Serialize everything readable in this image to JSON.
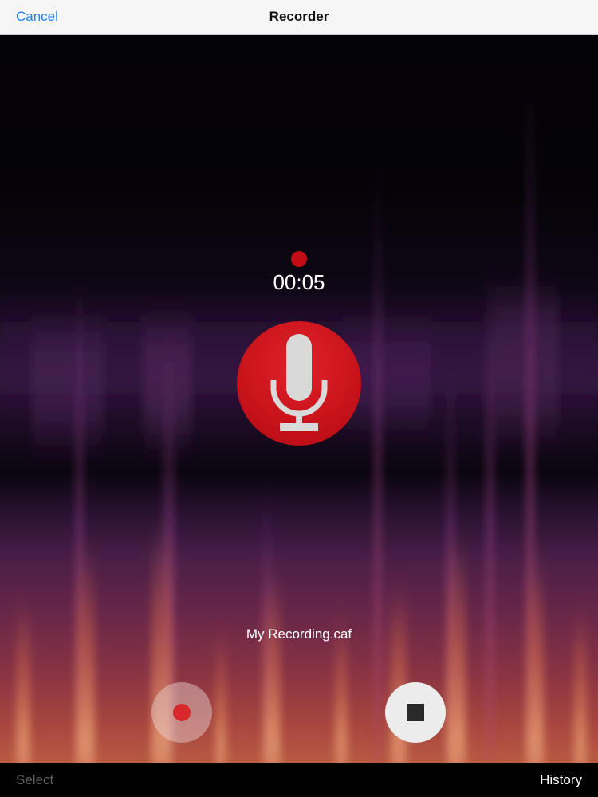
{
  "navbar": {
    "cancel_label": "Cancel",
    "title": "Recorder"
  },
  "recorder": {
    "status": "recording",
    "elapsed": "00:05",
    "filename": "My Recording.caf"
  },
  "controls": {
    "record_icon": "record-dot-icon",
    "stop_icon": "stop-square-icon",
    "mic_icon": "microphone-icon"
  },
  "bottombar": {
    "select_label": "Select",
    "history_label": "History"
  },
  "colors": {
    "accent_blue": "#1a82fb",
    "record_red": "#c8121a",
    "stop_dark": "#2a2a2a"
  }
}
